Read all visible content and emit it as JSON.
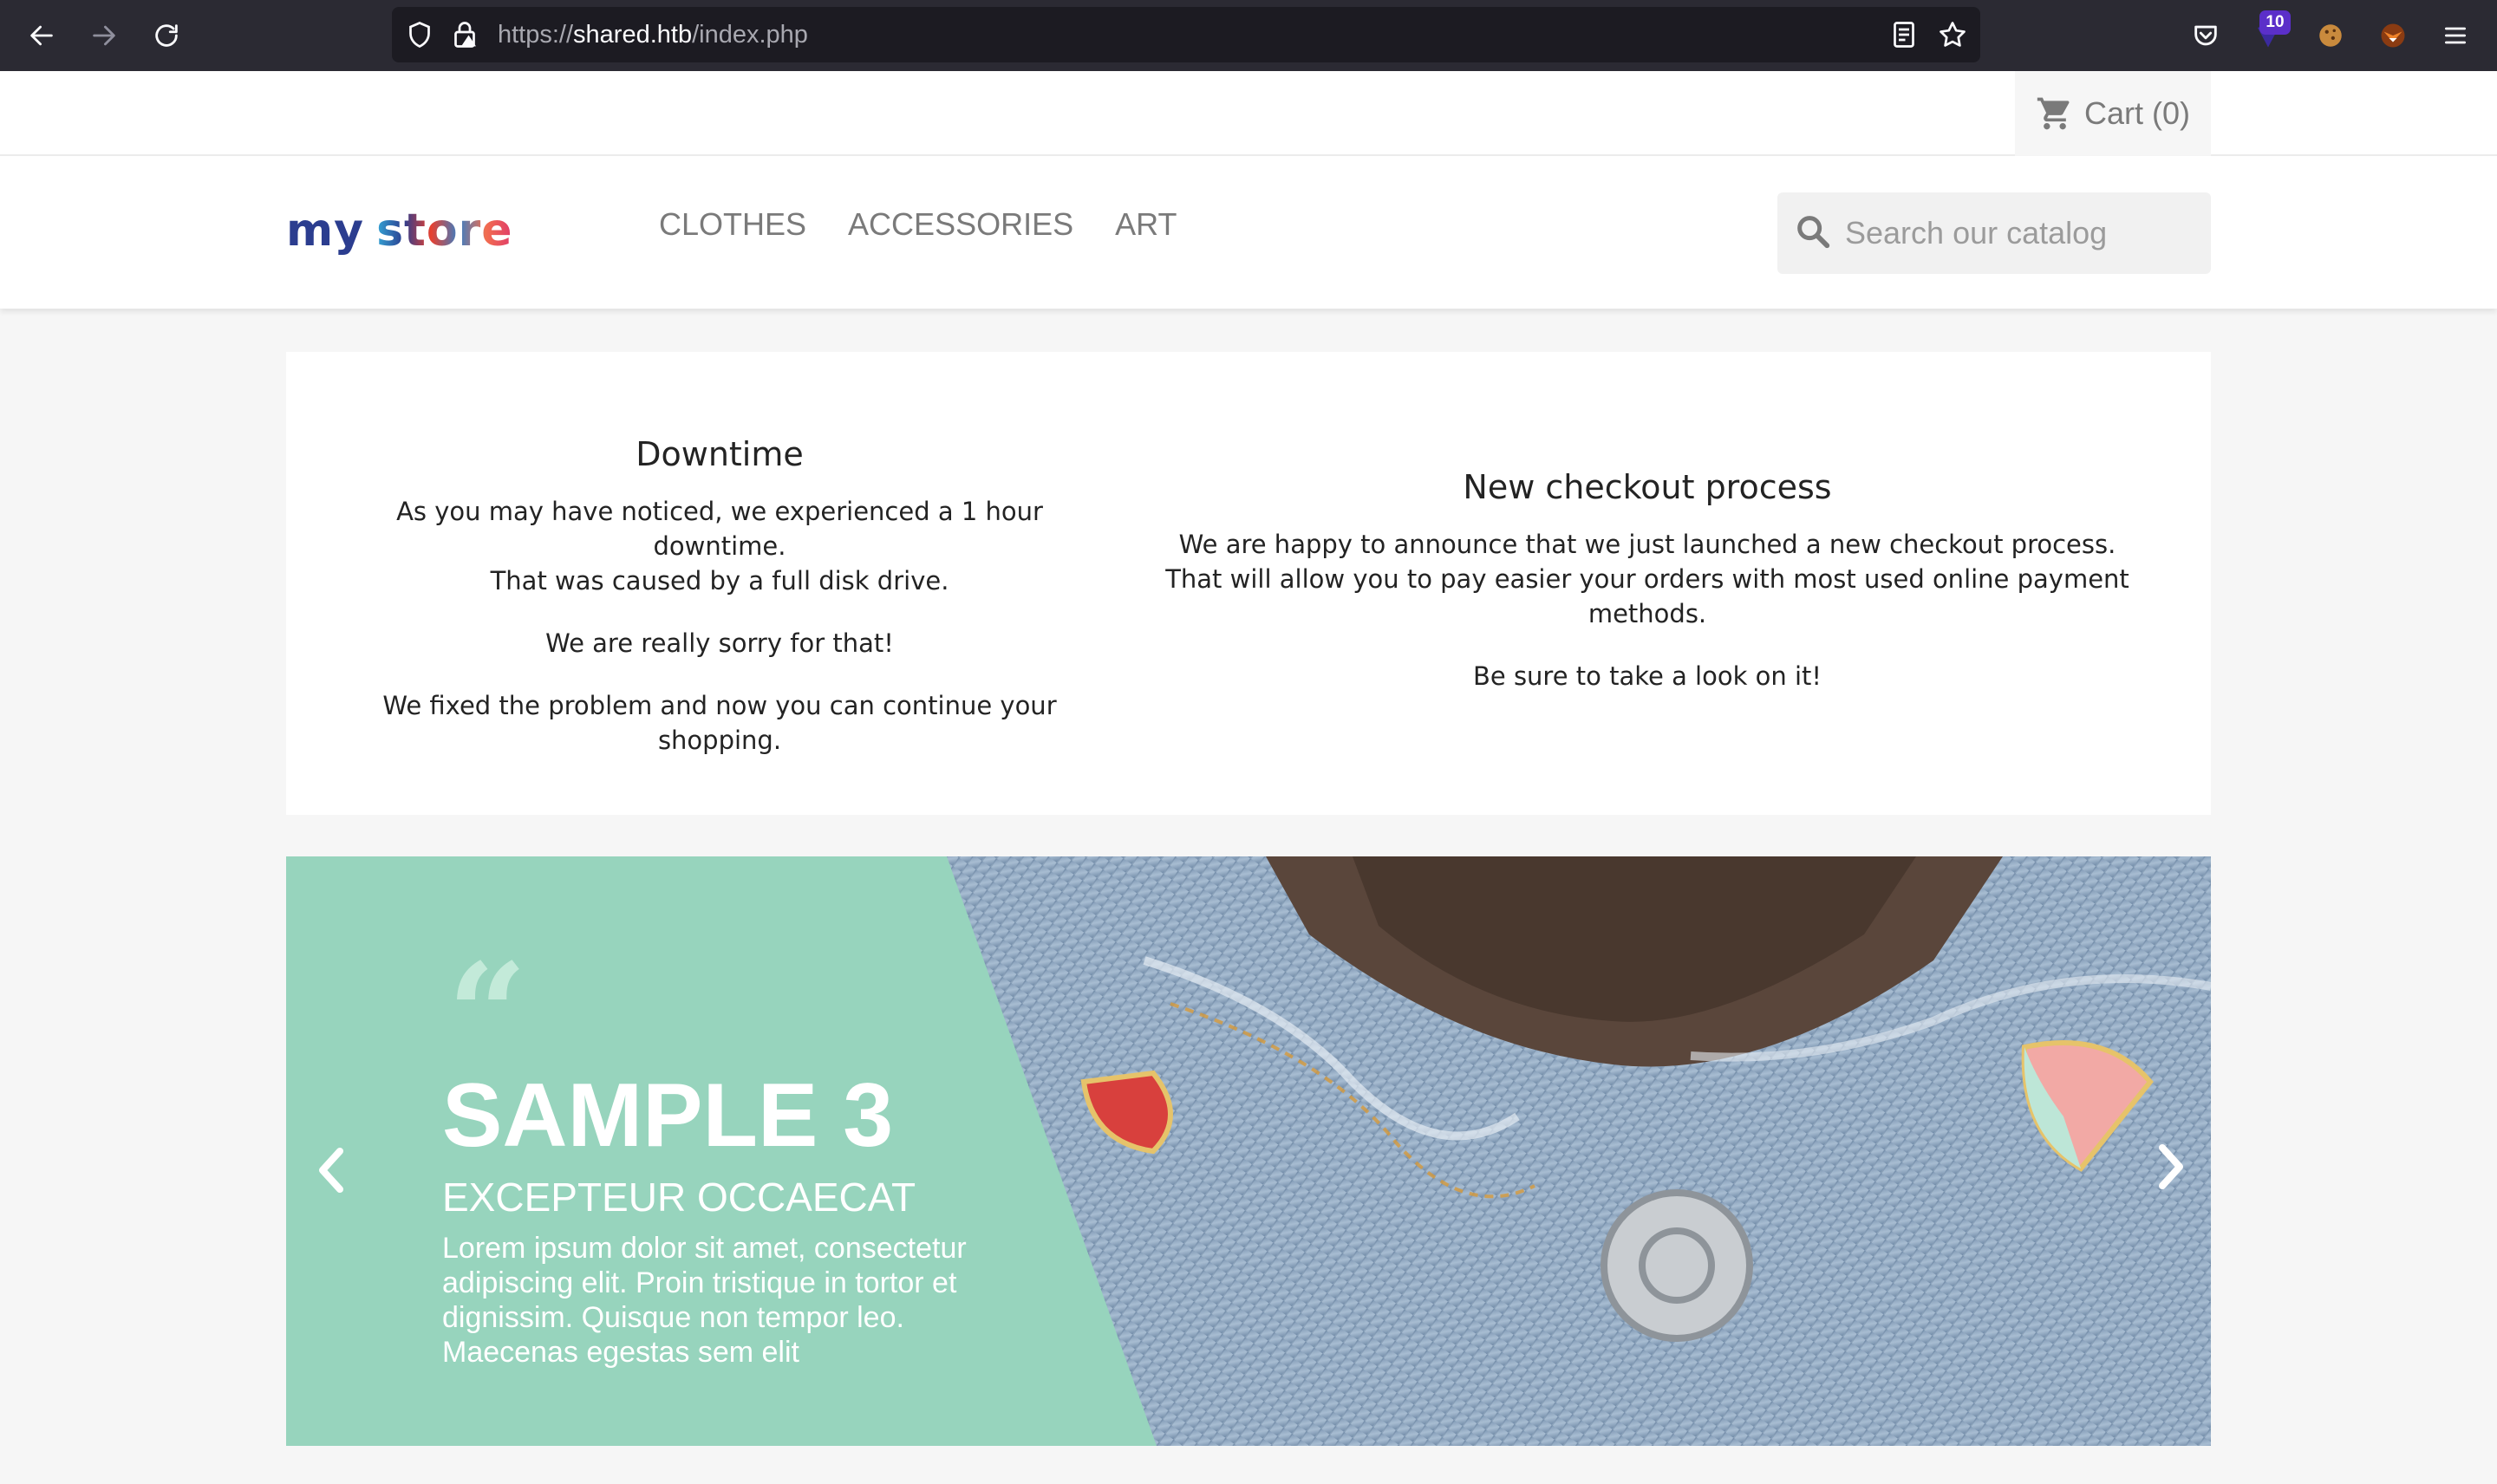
{
  "browser": {
    "url_prefix": "https://",
    "url_host": "shared.htb",
    "url_path": "/index.php",
    "extension_badge": "10"
  },
  "top": {
    "cart_label": "Cart (0)"
  },
  "header": {
    "logo": {
      "part1": "my",
      "part2": "store"
    },
    "menu": [
      {
        "label": "CLOTHES"
      },
      {
        "label": "ACCESSORIES"
      },
      {
        "label": "ART"
      }
    ],
    "search_placeholder": "Search our catalog"
  },
  "announcements": {
    "left": {
      "title": "Downtime",
      "p1_line1": "As you may have noticed, we experienced a 1 hour downtime.",
      "p1_line2": "That was caused by a full disk drive.",
      "p2": "We are really sorry for that!",
      "p3": "We fixed the problem and now you can continue your shopping."
    },
    "right": {
      "title": "New checkout process",
      "p1_line1": "We are happy to announce that we just launched a new checkout process.",
      "p1_line2": "That will allow you to pay easier your orders with most used online payment methods.",
      "p2": "Be sure to take a look on it!"
    }
  },
  "slider": {
    "quote": "“",
    "title": "SAMPLE 3",
    "subtitle": "EXCEPTEUR OCCAECAT",
    "text": "Lorem ipsum dolor sit amet, consectetur adipiscing elit. Proin tristique in tortor et dignissim. Quisque non tempor leo. Maecenas egestas sem elit",
    "accent_color": "#97d4bd"
  },
  "icons": [
    "back-arrow-icon",
    "forward-arrow-icon",
    "reload-icon",
    "shield-icon",
    "lock-icon",
    "reader-view-icon",
    "bookmark-star-icon",
    "pocket-icon",
    "extension-icon",
    "cookie-icon",
    "fox-icon",
    "hamburger-menu-icon",
    "cart-icon",
    "search-icon",
    "chevron-left-icon",
    "chevron-right-icon"
  ]
}
